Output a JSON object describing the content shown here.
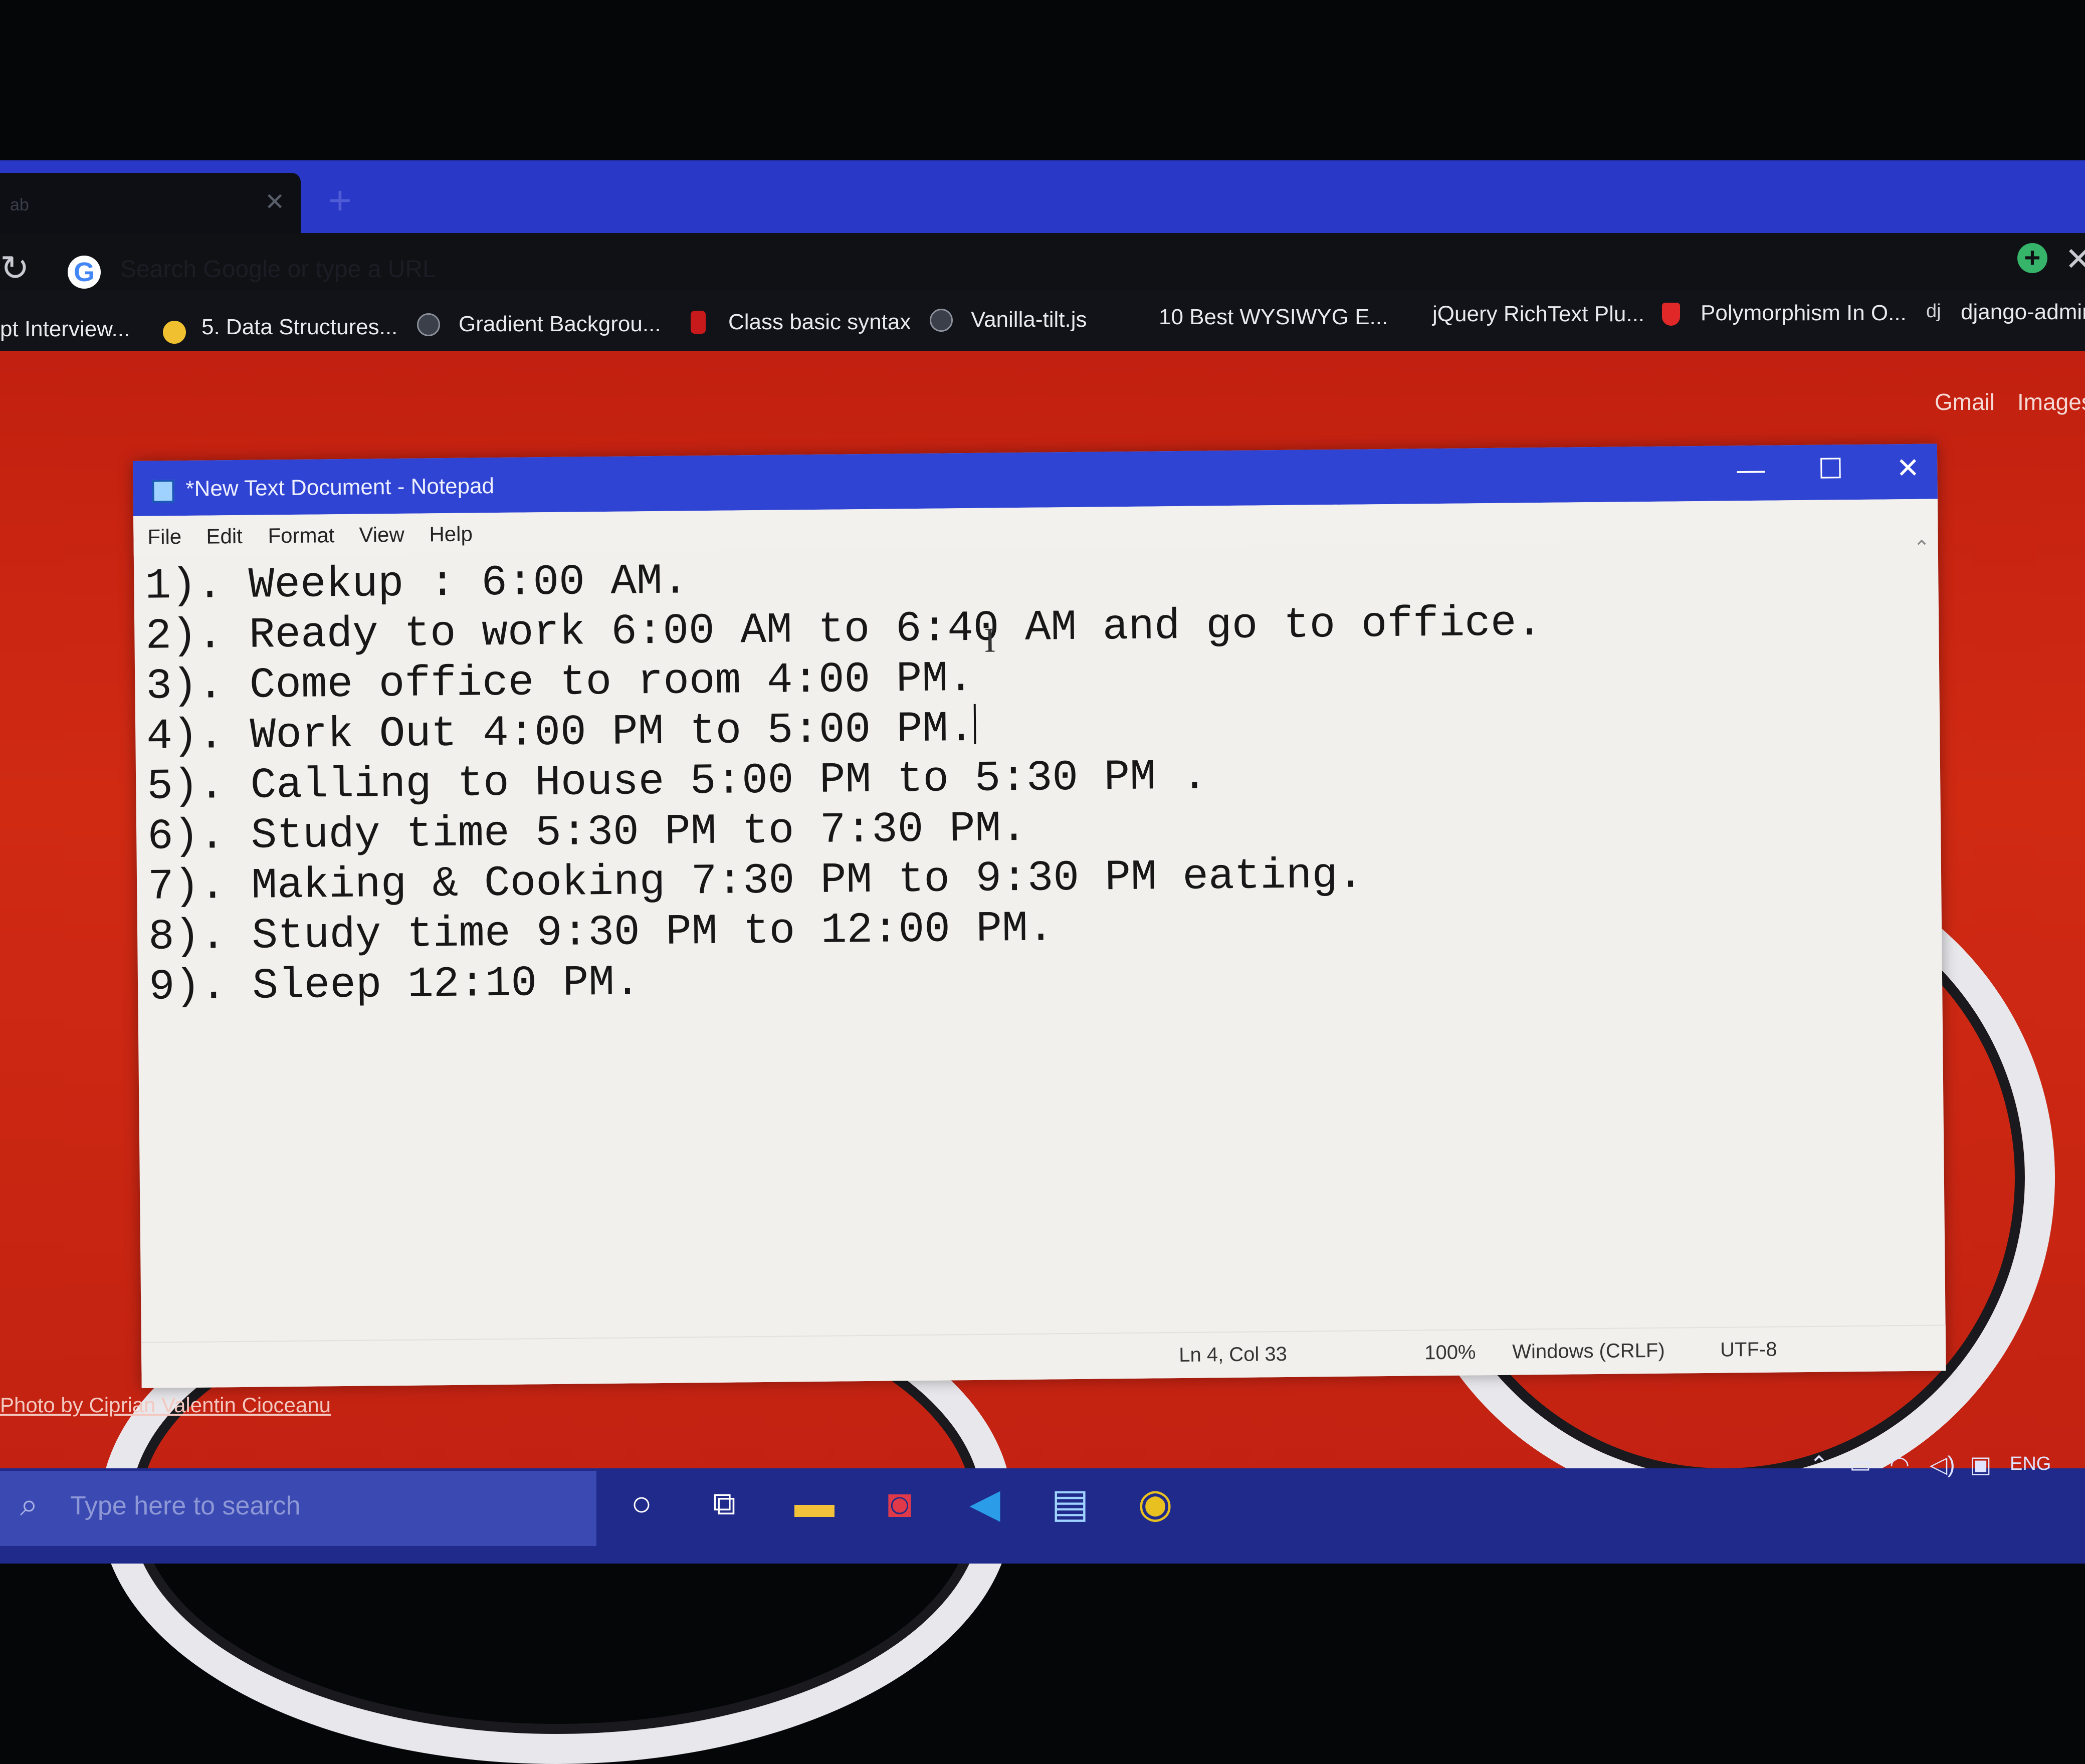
{
  "browser": {
    "tab_title": "ab",
    "omnibox_placeholder": "Search Google or type a URL",
    "bookmarks": [
      {
        "label": "pt Interview...",
        "icon": "page-icon"
      },
      {
        "label": "5. Data Structures...",
        "icon": "python-icon"
      },
      {
        "label": "Gradient Backgrou...",
        "icon": "globe-icon"
      },
      {
        "label": "Class basic syntax",
        "icon": "js-icon"
      },
      {
        "label": "Vanilla-tilt.js",
        "icon": "globe-icon"
      },
      {
        "label": "10 Best WYSIWYG E...",
        "icon": "page-icon"
      },
      {
        "label": "jQuery RichText Plu...",
        "icon": "page-icon"
      },
      {
        "label": "Polymorphism In O...",
        "icon": "shield-icon"
      },
      {
        "label": "django-admin",
        "icon": "django-icon",
        "prefix": "dj"
      }
    ],
    "top_links": {
      "gmail": "Gmail",
      "images": "Images"
    },
    "photo_credit": "Photo by Ciprian Valentin Cioceanu"
  },
  "notepad": {
    "title": "*New Text Document - Notepad",
    "menu": [
      "File",
      "Edit",
      "Format",
      "View",
      "Help"
    ],
    "lines": [
      "1). Weekup : 6:00 AM.",
      "2). Ready to work 6:00 AM to 6:40 AM and go to office.",
      "3). Come office to room 4:00 PM.",
      "4). Work Out 4:00 PM to 5:00 PM.",
      "5). Calling to House 5:00 PM to 5:30 PM .",
      "6). Study time 5:30 PM to 7:30 PM.",
      "7). Making & Cooking 7:30 PM to 9:30 PM eating.",
      "8). Study time 9:30 PM to 12:00 PM.",
      "9). Sleep 12:10 PM."
    ],
    "status": {
      "position": "Ln 4, Col 33",
      "zoom": "100%",
      "line_ending": "Windows (CRLF)",
      "encoding": "UTF-8"
    }
  },
  "taskbar": {
    "search_placeholder": "Type here to search",
    "apps": [
      "cortana-icon",
      "task-view-icon",
      "file-explorer-icon",
      "camera-app-icon",
      "vscode-icon",
      "notepad-icon",
      "chrome-icon"
    ],
    "tray_language": "ENG"
  },
  "colors": {
    "titlebar": "#3044d4",
    "tabstrip": "#2a38c8",
    "taskbar": "#1f2a8a",
    "wallpaper": "#c22010"
  }
}
